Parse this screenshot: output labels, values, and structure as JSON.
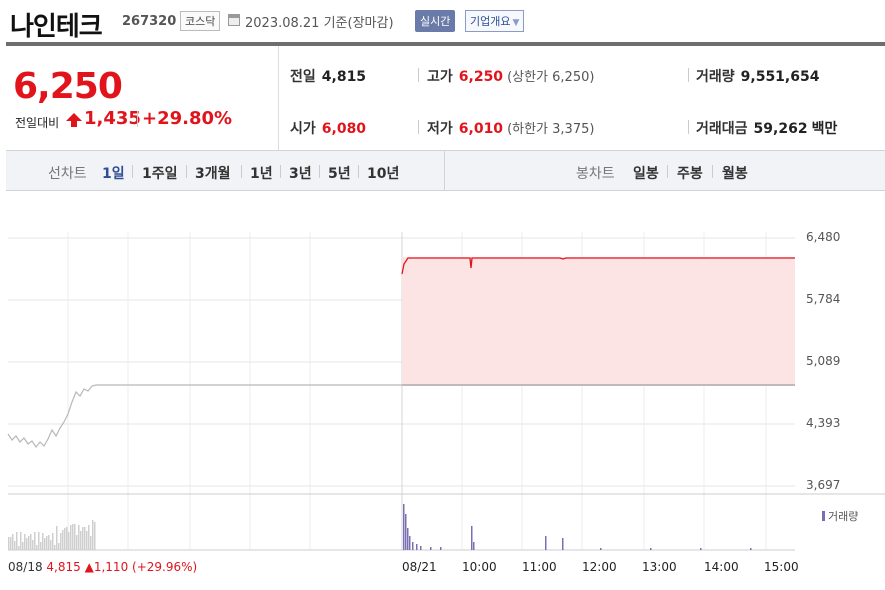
{
  "header": {
    "stock_name": "나인테크",
    "stock_code": "267320",
    "market": "코스닥",
    "date": "2023.08.21",
    "basis": "기준(장마감)",
    "realtime_label": "실시간",
    "company_label": "기업개요"
  },
  "price": {
    "current": "6,250",
    "diff_label": "전일대비",
    "diff_value": "1,435",
    "diff_pct": "+29.80%"
  },
  "stats": {
    "prev_label": "전일",
    "prev_value": "4,815",
    "high_label": "고가",
    "high_value": "6,250",
    "upper_limit": "(상한가 6,250)",
    "volume_label": "거래량",
    "volume_value": "9,551,654",
    "open_label": "시가",
    "open_value": "6,080",
    "low_label": "저가",
    "low_value": "6,010",
    "lower_limit": "(하한가 3,375)",
    "amount_label": "거래대금",
    "amount_value": "59,262",
    "amount_unit": "백만"
  },
  "tabs": {
    "line_label": "선차트",
    "periods": [
      "1일",
      "1주일",
      "3개월",
      "1년",
      "3년",
      "5년",
      "10년"
    ],
    "selected": "1일",
    "candle_label": "봉차트",
    "candles": [
      "일봉",
      "주봉",
      "월봉"
    ]
  },
  "colors": {
    "up": "#e1141c",
    "selected_tab": "#2f4d94",
    "volume": "#7b6fb3",
    "fill": "#fce3e4"
  },
  "chart_data": {
    "type": "line",
    "y_ticks": [
      "6,480",
      "5,784",
      "5,089",
      "4,393",
      "3,697"
    ],
    "ylim": [
      3697,
      6480
    ],
    "x_ticks": [
      "08/18",
      "08/21",
      "10:00",
      "11:00",
      "12:00",
      "13:00",
      "14:00",
      "15:00"
    ],
    "grid": true,
    "volume_label": "거래량",
    "bottom_info": {
      "prev_close": "4,815",
      "change": "1,110",
      "change_pct": "(+29.96%)"
    }
  }
}
